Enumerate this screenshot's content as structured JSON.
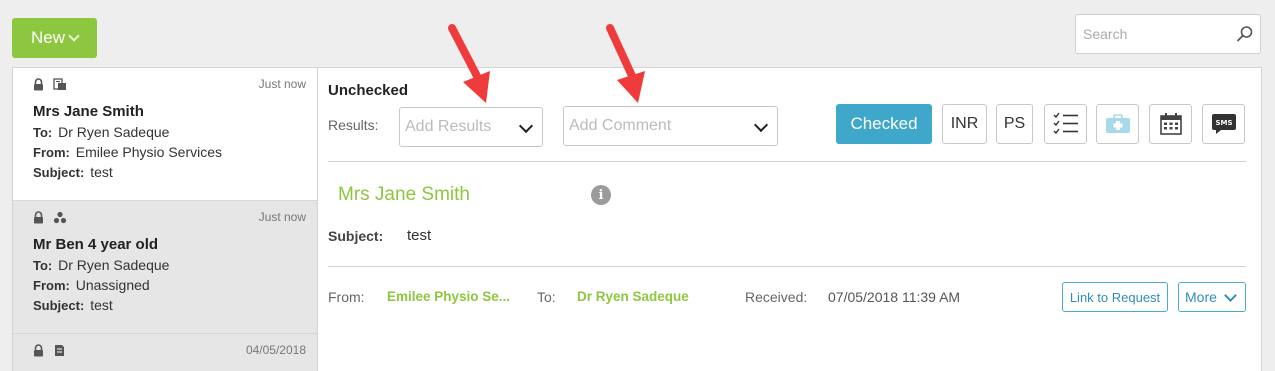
{
  "toolbar": {
    "new_label": "New"
  },
  "search": {
    "placeholder": "Search"
  },
  "messages": [
    {
      "time": "Just now",
      "name": "Mrs Jane Smith",
      "to_label": "To:",
      "to": "Dr Ryen Sadeque",
      "from_label": "From:",
      "from": "Emilee Physio Services",
      "subject_label": "Subject:",
      "subject": "test"
    },
    {
      "time": "Just now",
      "name": "Mr Ben 4 year old",
      "to_label": "To:",
      "to": "Dr Ryen Sadeque",
      "from_label": "From:",
      "from": "Unassigned",
      "subject_label": "Subject:",
      "subject": "test"
    },
    {
      "time": "04/05/2018"
    }
  ],
  "detail": {
    "status": "Unchecked",
    "results_label": "Results:",
    "results_placeholder": "Add Results",
    "comment_placeholder": "Add Comment",
    "checked_label": "Checked",
    "inr_label": "INR",
    "ps_label": "PS",
    "sms_label": "SMS",
    "patient_name": "Mrs Jane Smith",
    "info_glyph": "i",
    "subject_label": "Subject:",
    "subject": "test",
    "from_label": "From:",
    "from": "Emilee Physio Se...",
    "to_label": "To:",
    "to": "Dr Ryen Sadeque",
    "received_label": "Received:",
    "received": "07/05/2018 11:39 AM",
    "link_label": "Link to Request",
    "more_label": "More"
  },
  "colors": {
    "brand_green": "#8dc63f",
    "accent_blue": "#3fa7c9",
    "arrow_red": "#ef3b3b"
  }
}
